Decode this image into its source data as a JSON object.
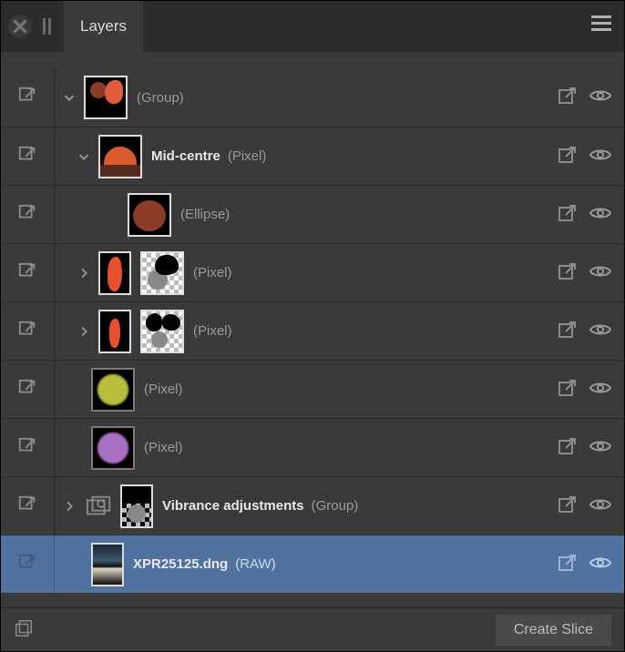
{
  "header": {
    "tab_label": "Layers"
  },
  "layers": [
    {
      "name": "",
      "type": "(Group)"
    },
    {
      "name": "Mid-centre",
      "type": "(Pixel)"
    },
    {
      "name": "",
      "type": "(Ellipse)"
    },
    {
      "name": "",
      "type": "(Pixel)"
    },
    {
      "name": "",
      "type": "(Pixel)"
    },
    {
      "name": "",
      "type": "(Pixel)"
    },
    {
      "name": "",
      "type": "(Pixel)"
    },
    {
      "name": "Vibrance adjustments",
      "type": "(Group)"
    },
    {
      "name": "XPR25125.dng",
      "type": "(RAW)"
    }
  ],
  "footer": {
    "create_slice_label": "Create Slice"
  }
}
